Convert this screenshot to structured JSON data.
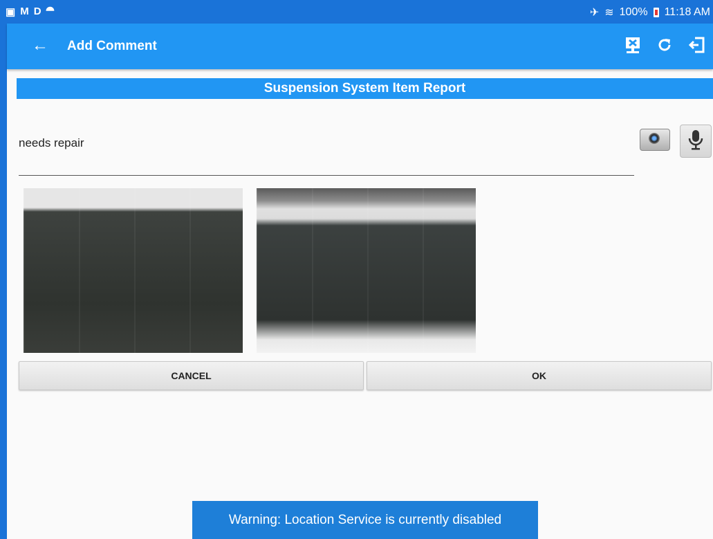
{
  "status_bar": {
    "left_icons": [
      "▣",
      "M",
      "D",
      "⯊"
    ],
    "battery_percent": "100%",
    "time": "11:18 AM"
  },
  "app_bar": {
    "back_icon": "←",
    "title": "Add Comment",
    "icons": [
      "sync-icon",
      "refresh-icon",
      "logout-icon"
    ]
  },
  "section": {
    "title": "Suspension System Item Report"
  },
  "comment": {
    "value": "needs repair"
  },
  "buttons": {
    "cancel": "CANCEL",
    "ok": "OK"
  },
  "toast": {
    "message": "Warning: Location Service is currently disabled"
  },
  "colors": {
    "status_bar": "#1a73d8",
    "app_bar": "#2196f3",
    "toast": "#1e7fd8"
  }
}
